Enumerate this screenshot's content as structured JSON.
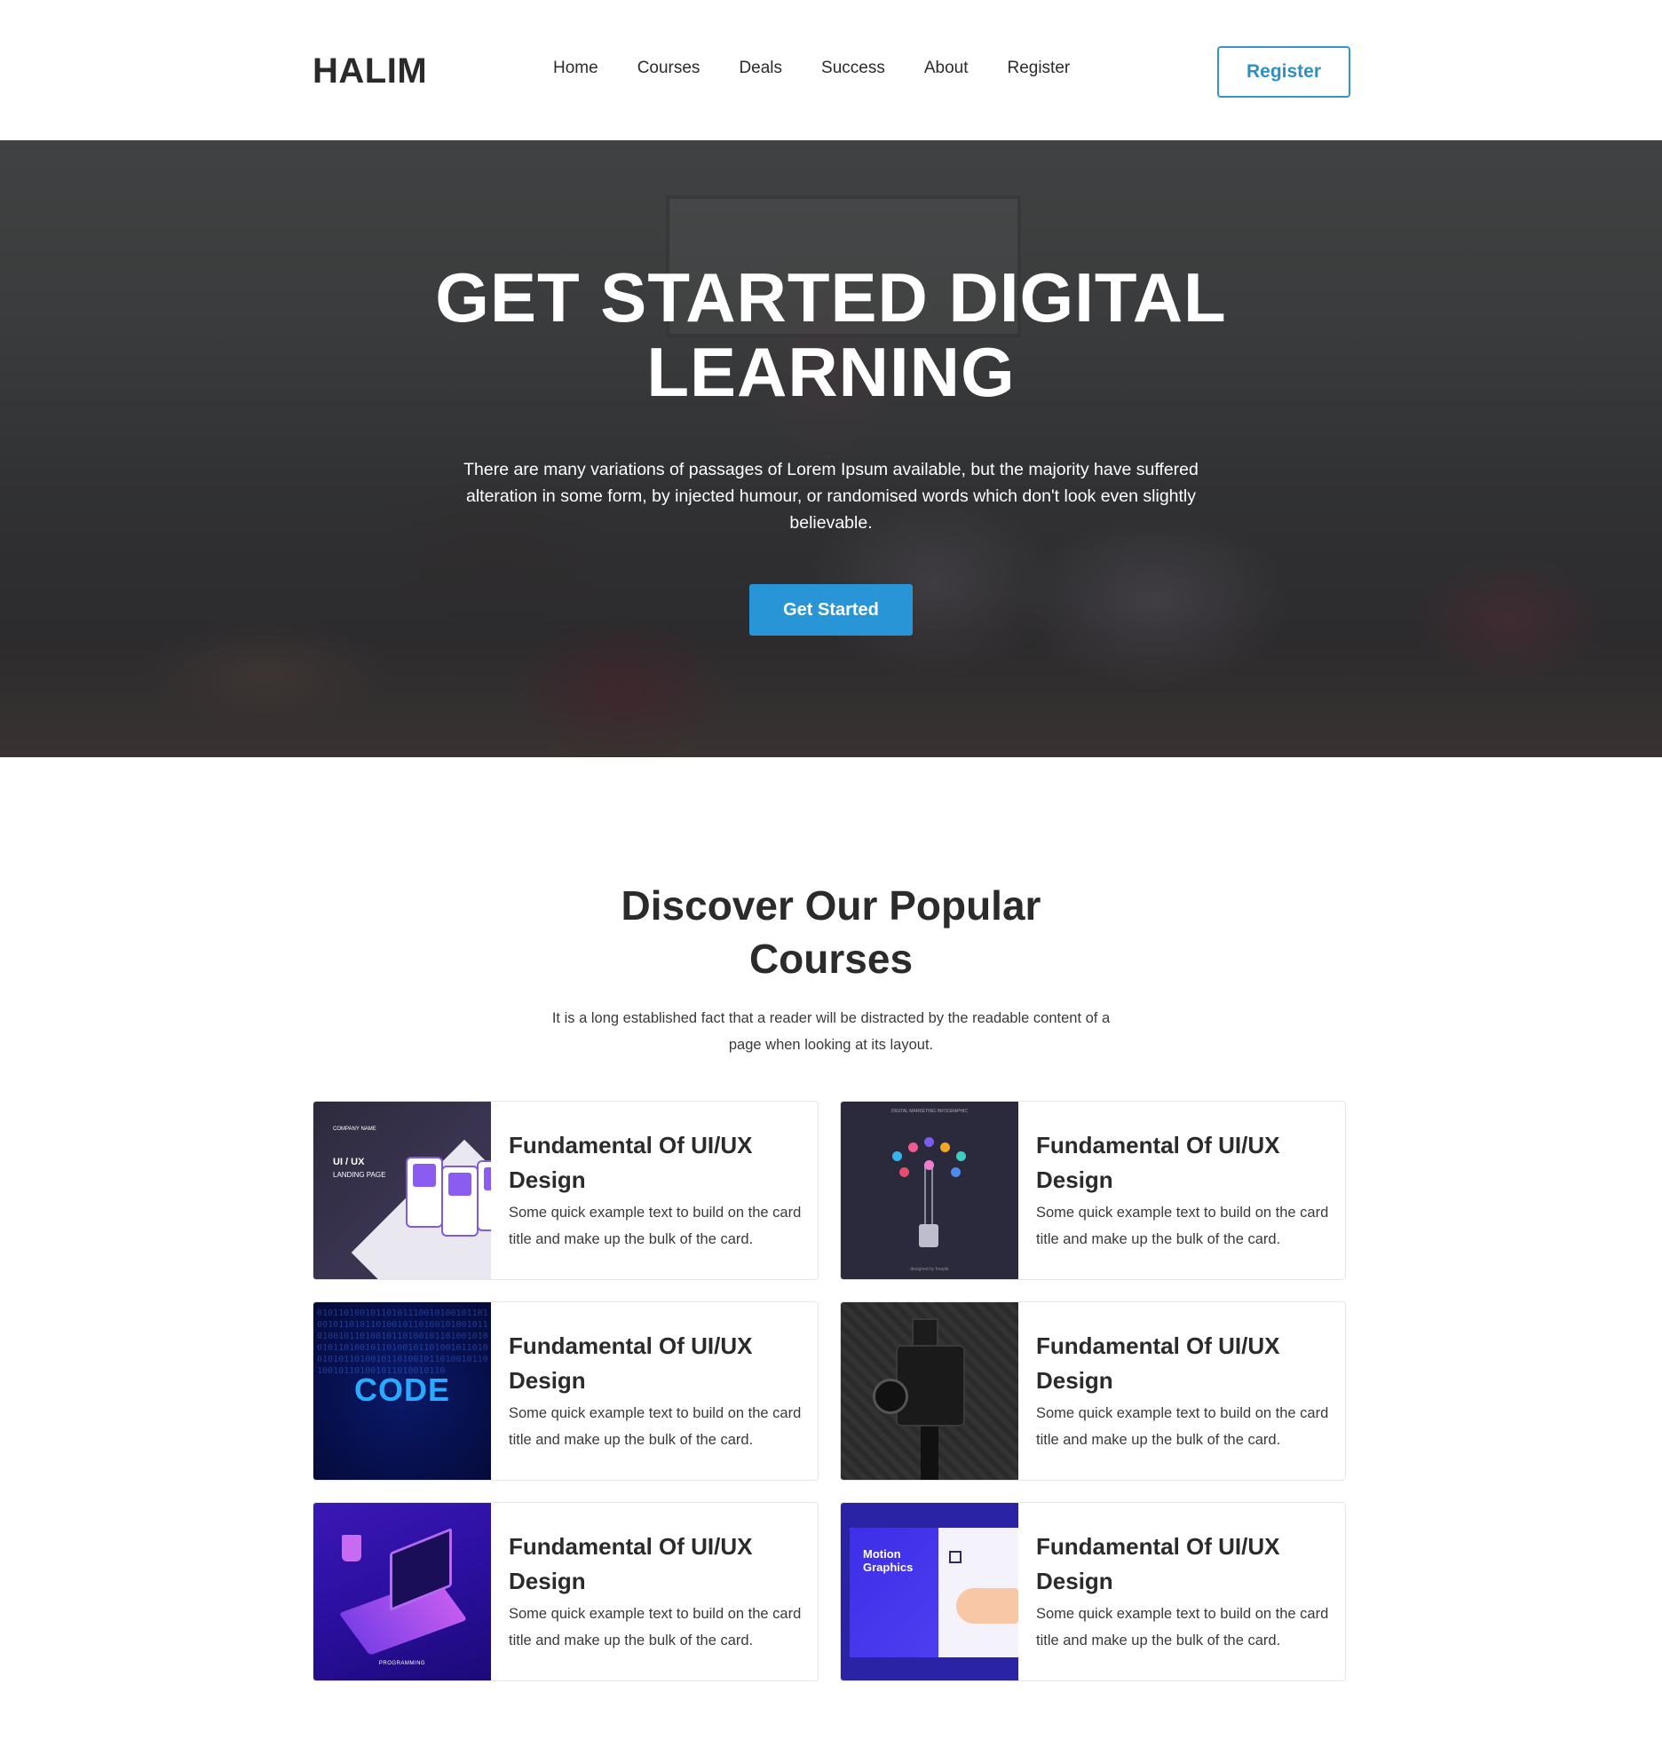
{
  "brand": {
    "logo": "HALIM"
  },
  "nav": {
    "items": [
      {
        "label": "Home"
      },
      {
        "label": "Courses"
      },
      {
        "label": "Deals"
      },
      {
        "label": "Success"
      },
      {
        "label": "About"
      },
      {
        "label": "Register"
      }
    ],
    "register_button": "Register"
  },
  "hero": {
    "title_line1": "GET STARTED DIGITAL",
    "title_line2": "LEARNING",
    "text": "There are many variations of passages of Lorem Ipsum available, but the majority have suffered alteration in some form, by injected humour, or randomised words which don't look even slightly believable.",
    "cta": "Get Started"
  },
  "courses": {
    "title_line1": "Discover Our Popular",
    "title_line2": "Courses",
    "subtitle": "It is a long established fact that a reader will be distracted by the readable content of a page when looking at its layout.",
    "cards": [
      {
        "title": "Fundamental Of UI/UX Design",
        "text": "Some quick example text to build on the card title and make up the bulk of the card.",
        "image": "ui-ux-landing-page"
      },
      {
        "title": "Fundamental Of UI/UX Design",
        "text": "Some quick example text to build on the card title and make up the bulk of the card.",
        "image": "digital-marketing-infographic"
      },
      {
        "title": "Fundamental Of UI/UX Design",
        "text": "Some quick example text to build on the card title and make up the bulk of the card.",
        "image": "code-binary"
      },
      {
        "title": "Fundamental Of UI/UX Design",
        "text": "Some quick example text to build on the card title and make up the bulk of the card.",
        "image": "camera"
      },
      {
        "title": "Fundamental Of UI/UX Design",
        "text": "Some quick example text to build on the card title and make up the bulk of the card.",
        "image": "isometric-laptop-programming"
      },
      {
        "title": "Fundamental Of UI/UX Design",
        "text": "Some quick example text to build on the card title and make up the bulk of the card.",
        "image": "motion-graphics"
      }
    ],
    "thumb_text": {
      "ui_company": "COMPANY NAME",
      "ui_title": "UI / UX",
      "ui_sub": "LANDING PAGE",
      "dm_title": "DIGITAL MARKETING INFOGRAPHIC",
      "dm_credit": "designed by freepik",
      "code": "CODE",
      "code_bits": "0101101001011010111001010010110100101101011010010110100101001011010010110100101101001011010010100101101001011010010110100101101001010110100101101001011010010110100101101001011010010110",
      "prog": "PROGRAMMING",
      "motion": "Motion Graphics"
    }
  },
  "colors": {
    "accent": "#2795d6",
    "register_border": "#3196c9",
    "text_dark": "#2b2b2b"
  }
}
